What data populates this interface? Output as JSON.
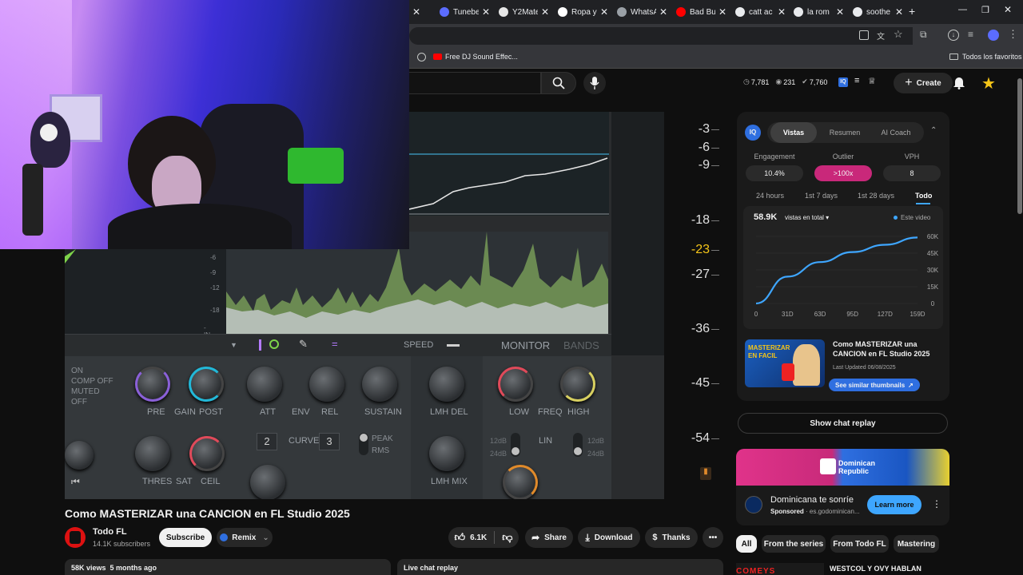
{
  "browser": {
    "tabs": [
      {
        "label": "Tunebe",
        "color": "#5b6cff"
      },
      {
        "label": "Y2Mate",
        "color": "#e6e6e6"
      },
      {
        "label": "Ropa y",
        "color": "#ffffff"
      },
      {
        "label": "WhatsA",
        "color": "#9aa0a6"
      },
      {
        "label": "Bad Bu",
        "color": "#ff0000"
      },
      {
        "label": "catt ac",
        "color": "#e8eaed"
      },
      {
        "label": "la rom",
        "color": "#e8eaed"
      },
      {
        "label": "soothe",
        "color": "#e8eaed"
      }
    ],
    "bookmark": "Free DJ Sound Effec...",
    "all_bookmarks": "Todos los favoritos"
  },
  "header": {
    "stats": [
      {
        "icon": "clock-icon",
        "value": "7,781"
      },
      {
        "icon": "eye-icon",
        "value": "231"
      },
      {
        "icon": "check-icon",
        "value": "7,760"
      }
    ],
    "create_label": "Create"
  },
  "player": {
    "db_labels": [
      "-3",
      "-6",
      "-9",
      "-18",
      "-23",
      "-27",
      "-36",
      "-45",
      "-54"
    ],
    "plugin": {
      "speed": "SPEED",
      "monitor": "MONITOR",
      "bands": "BANDS",
      "mode_lines": [
        "ON",
        "COMP OFF",
        "MUTED",
        "OFF"
      ],
      "knob_labels": [
        "PRE",
        "GAIN",
        "POST",
        "ATT",
        "ENV",
        "REL",
        "SUSTAIN",
        "LMH DEL",
        "LOW",
        "FREQ",
        "HIGH",
        "THRES",
        "SAT",
        "CEIL",
        "CURVE",
        "LMH MIX",
        "LIN"
      ],
      "curve_left": "2",
      "curve_right": "3",
      "peak": "PEAK",
      "rms": "RMS",
      "db12": "12dB",
      "db24": "24dB",
      "scale": [
        "-6",
        "-9",
        "-12",
        "-18",
        "-IN"
      ]
    }
  },
  "video": {
    "title": "Como MASTERIZAR una CANCION en FL Studio 2025",
    "channel": "Todo FL",
    "subscribers": "14.1K subscribers",
    "subscribe_label": "Subscribe",
    "remix_label": "Remix",
    "likes": "6.1K",
    "share_label": "Share",
    "download_label": "Download",
    "thanks_label": "Thanks",
    "views_line": "58K views  5 months ago",
    "live_chat": "Live chat replay"
  },
  "iq_panel": {
    "tabs": [
      "Vistas",
      "Resumen",
      "AI Coach"
    ],
    "active_tab": "Vistas",
    "stats": [
      {
        "label": "Engagement",
        "value": "10.4%"
      },
      {
        "label": "Outlier",
        "value": ">100x"
      },
      {
        "label": "VPH",
        "value": "8"
      }
    ],
    "ranges": [
      "24 hours",
      "1st 7 days",
      "1st 28 days",
      "Todo"
    ],
    "active_range": "Todo",
    "total": "58.9K",
    "total_label": "vistas en total",
    "legend": "Este video",
    "thumb_title": "Como MASTERIZAR una CANCION en FL Studio 2025",
    "updated": "Last Updated 06/08/2025",
    "similar_label": "See similar thumbnails",
    "thumb_text": "MASTERIZAR EN FACIL"
  },
  "chart_data": {
    "type": "line",
    "x": [
      0,
      31,
      63,
      95,
      127,
      159
    ],
    "x_labels": [
      "0",
      "31D",
      "63D",
      "95D",
      "127D",
      "159D"
    ],
    "series": [
      {
        "name": "Este video",
        "values": [
          0,
          24000,
          37000,
          46000,
          52500,
          59000
        ]
      }
    ],
    "y_ticks": [
      "0",
      "15K",
      "30K",
      "45K",
      "60K"
    ],
    "ylim": [
      0,
      60000
    ],
    "color": "#3ea6ff"
  },
  "chat": {
    "show_replay": "Show chat replay"
  },
  "ad": {
    "brand": "Dominican Republic",
    "headline": "Dominicana te sonríe",
    "sponsored": "Sponsored",
    "domain": "es.godominican...",
    "cta": "Learn more"
  },
  "chips": [
    "All",
    "From the series",
    "From Todo FL",
    "Mastering"
  ],
  "next_video": {
    "title": "WESTCOL Y OVY HABLAN",
    "thumb_text": "COMEYS"
  },
  "colors": {
    "accent": "#3ea6ff",
    "outlier": "#c9287a",
    "meter_green": "#9ed36a",
    "knob_blue": "#22b8d8",
    "knob_red": "#e04a5a"
  }
}
